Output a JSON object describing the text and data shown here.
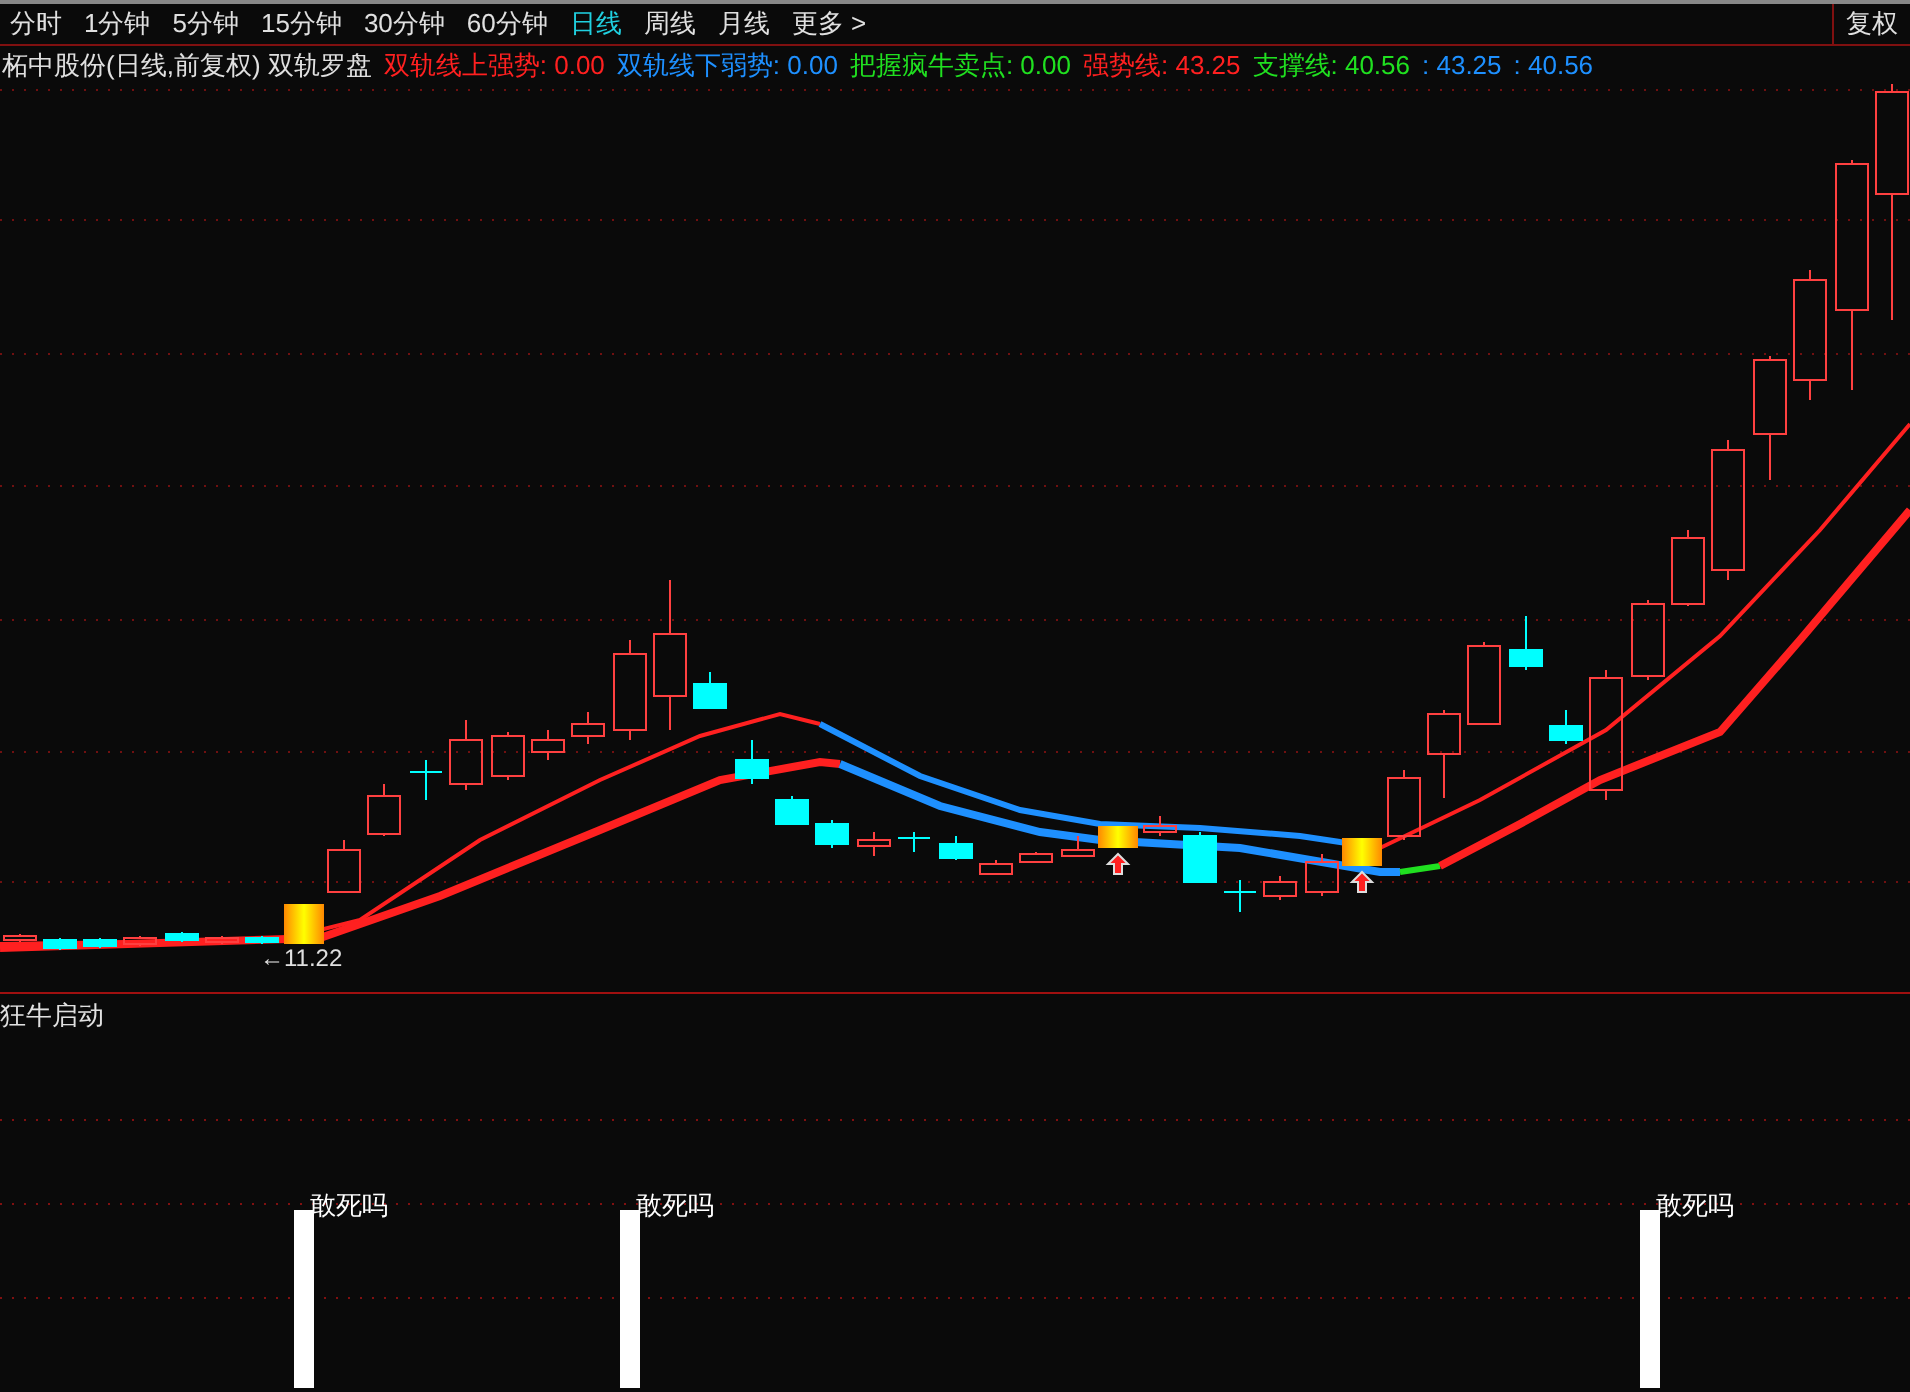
{
  "periods": [
    {
      "label": "分时",
      "selected": false
    },
    {
      "label": "1分钟",
      "selected": false
    },
    {
      "label": "5分钟",
      "selected": false
    },
    {
      "label": "15分钟",
      "selected": false
    },
    {
      "label": "30分钟",
      "selected": false
    },
    {
      "label": "60分钟",
      "selected": false
    },
    {
      "label": "日线",
      "selected": true
    },
    {
      "label": "周线",
      "selected": false
    },
    {
      "label": "月线",
      "selected": false
    },
    {
      "label": "更多 >",
      "selected": false
    }
  ],
  "adjust_button": "复权",
  "chart_title": "柘中股份(日线,前复权) 双轨罗盘",
  "legend": [
    {
      "text": "双轨线上强势: 0.00",
      "color": "#ff2020"
    },
    {
      "text": "双轨线下弱势: 0.00",
      "color": "#1e90ff"
    },
    {
      "text": "把握疯牛卖点: 0.00",
      "color": "#20e020"
    },
    {
      "text": "强势线: 43.25",
      "color": "#ff2020"
    },
    {
      "text": "支撑线: 40.56",
      "color": "#20e020"
    },
    {
      "text": ": 43.25",
      "color": "#1e90ff"
    },
    {
      "text": ": 40.56",
      "color": "#1e90ff"
    }
  ],
  "price_label": "←11.22",
  "indicator_panel": {
    "title": "狂牛启动",
    "bar_labels": [
      "敢死吗",
      "敢死吗",
      "敢死吗"
    ]
  }
}
